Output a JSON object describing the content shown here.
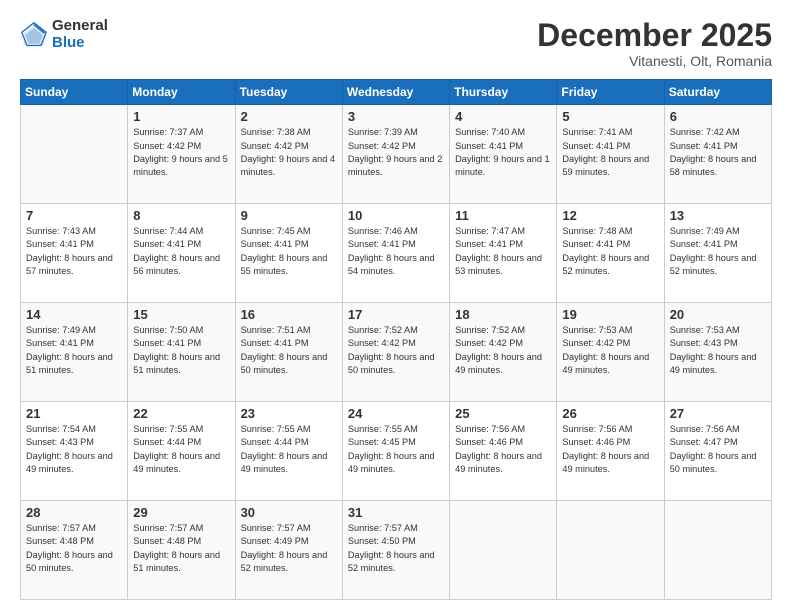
{
  "logo": {
    "general": "General",
    "blue": "Blue"
  },
  "header": {
    "month": "December 2025",
    "location": "Vitanesti, Olt, Romania"
  },
  "weekdays": [
    "Sunday",
    "Monday",
    "Tuesday",
    "Wednesday",
    "Thursday",
    "Friday",
    "Saturday"
  ],
  "weeks": [
    [
      {
        "day": "",
        "sunrise": "",
        "sunset": "",
        "daylight": ""
      },
      {
        "day": "1",
        "sunrise": "Sunrise: 7:37 AM",
        "sunset": "Sunset: 4:42 PM",
        "daylight": "Daylight: 9 hours and 5 minutes."
      },
      {
        "day": "2",
        "sunrise": "Sunrise: 7:38 AM",
        "sunset": "Sunset: 4:42 PM",
        "daylight": "Daylight: 9 hours and 4 minutes."
      },
      {
        "day": "3",
        "sunrise": "Sunrise: 7:39 AM",
        "sunset": "Sunset: 4:42 PM",
        "daylight": "Daylight: 9 hours and 2 minutes."
      },
      {
        "day": "4",
        "sunrise": "Sunrise: 7:40 AM",
        "sunset": "Sunset: 4:41 PM",
        "daylight": "Daylight: 9 hours and 1 minute."
      },
      {
        "day": "5",
        "sunrise": "Sunrise: 7:41 AM",
        "sunset": "Sunset: 4:41 PM",
        "daylight": "Daylight: 8 hours and 59 minutes."
      },
      {
        "day": "6",
        "sunrise": "Sunrise: 7:42 AM",
        "sunset": "Sunset: 4:41 PM",
        "daylight": "Daylight: 8 hours and 58 minutes."
      }
    ],
    [
      {
        "day": "7",
        "sunrise": "Sunrise: 7:43 AM",
        "sunset": "Sunset: 4:41 PM",
        "daylight": "Daylight: 8 hours and 57 minutes."
      },
      {
        "day": "8",
        "sunrise": "Sunrise: 7:44 AM",
        "sunset": "Sunset: 4:41 PM",
        "daylight": "Daylight: 8 hours and 56 minutes."
      },
      {
        "day": "9",
        "sunrise": "Sunrise: 7:45 AM",
        "sunset": "Sunset: 4:41 PM",
        "daylight": "Daylight: 8 hours and 55 minutes."
      },
      {
        "day": "10",
        "sunrise": "Sunrise: 7:46 AM",
        "sunset": "Sunset: 4:41 PM",
        "daylight": "Daylight: 8 hours and 54 minutes."
      },
      {
        "day": "11",
        "sunrise": "Sunrise: 7:47 AM",
        "sunset": "Sunset: 4:41 PM",
        "daylight": "Daylight: 8 hours and 53 minutes."
      },
      {
        "day": "12",
        "sunrise": "Sunrise: 7:48 AM",
        "sunset": "Sunset: 4:41 PM",
        "daylight": "Daylight: 8 hours and 52 minutes."
      },
      {
        "day": "13",
        "sunrise": "Sunrise: 7:49 AM",
        "sunset": "Sunset: 4:41 PM",
        "daylight": "Daylight: 8 hours and 52 minutes."
      }
    ],
    [
      {
        "day": "14",
        "sunrise": "Sunrise: 7:49 AM",
        "sunset": "Sunset: 4:41 PM",
        "daylight": "Daylight: 8 hours and 51 minutes."
      },
      {
        "day": "15",
        "sunrise": "Sunrise: 7:50 AM",
        "sunset": "Sunset: 4:41 PM",
        "daylight": "Daylight: 8 hours and 51 minutes."
      },
      {
        "day": "16",
        "sunrise": "Sunrise: 7:51 AM",
        "sunset": "Sunset: 4:41 PM",
        "daylight": "Daylight: 8 hours and 50 minutes."
      },
      {
        "day": "17",
        "sunrise": "Sunrise: 7:52 AM",
        "sunset": "Sunset: 4:42 PM",
        "daylight": "Daylight: 8 hours and 50 minutes."
      },
      {
        "day": "18",
        "sunrise": "Sunrise: 7:52 AM",
        "sunset": "Sunset: 4:42 PM",
        "daylight": "Daylight: 8 hours and 49 minutes."
      },
      {
        "day": "19",
        "sunrise": "Sunrise: 7:53 AM",
        "sunset": "Sunset: 4:42 PM",
        "daylight": "Daylight: 8 hours and 49 minutes."
      },
      {
        "day": "20",
        "sunrise": "Sunrise: 7:53 AM",
        "sunset": "Sunset: 4:43 PM",
        "daylight": "Daylight: 8 hours and 49 minutes."
      }
    ],
    [
      {
        "day": "21",
        "sunrise": "Sunrise: 7:54 AM",
        "sunset": "Sunset: 4:43 PM",
        "daylight": "Daylight: 8 hours and 49 minutes."
      },
      {
        "day": "22",
        "sunrise": "Sunrise: 7:55 AM",
        "sunset": "Sunset: 4:44 PM",
        "daylight": "Daylight: 8 hours and 49 minutes."
      },
      {
        "day": "23",
        "sunrise": "Sunrise: 7:55 AM",
        "sunset": "Sunset: 4:44 PM",
        "daylight": "Daylight: 8 hours and 49 minutes."
      },
      {
        "day": "24",
        "sunrise": "Sunrise: 7:55 AM",
        "sunset": "Sunset: 4:45 PM",
        "daylight": "Daylight: 8 hours and 49 minutes."
      },
      {
        "day": "25",
        "sunrise": "Sunrise: 7:56 AM",
        "sunset": "Sunset: 4:46 PM",
        "daylight": "Daylight: 8 hours and 49 minutes."
      },
      {
        "day": "26",
        "sunrise": "Sunrise: 7:56 AM",
        "sunset": "Sunset: 4:46 PM",
        "daylight": "Daylight: 8 hours and 49 minutes."
      },
      {
        "day": "27",
        "sunrise": "Sunrise: 7:56 AM",
        "sunset": "Sunset: 4:47 PM",
        "daylight": "Daylight: 8 hours and 50 minutes."
      }
    ],
    [
      {
        "day": "28",
        "sunrise": "Sunrise: 7:57 AM",
        "sunset": "Sunset: 4:48 PM",
        "daylight": "Daylight: 8 hours and 50 minutes."
      },
      {
        "day": "29",
        "sunrise": "Sunrise: 7:57 AM",
        "sunset": "Sunset: 4:48 PM",
        "daylight": "Daylight: 8 hours and 51 minutes."
      },
      {
        "day": "30",
        "sunrise": "Sunrise: 7:57 AM",
        "sunset": "Sunset: 4:49 PM",
        "daylight": "Daylight: 8 hours and 52 minutes."
      },
      {
        "day": "31",
        "sunrise": "Sunrise: 7:57 AM",
        "sunset": "Sunset: 4:50 PM",
        "daylight": "Daylight: 8 hours and 52 minutes."
      },
      {
        "day": "",
        "sunrise": "",
        "sunset": "",
        "daylight": ""
      },
      {
        "day": "",
        "sunrise": "",
        "sunset": "",
        "daylight": ""
      },
      {
        "day": "",
        "sunrise": "",
        "sunset": "",
        "daylight": ""
      }
    ]
  ]
}
